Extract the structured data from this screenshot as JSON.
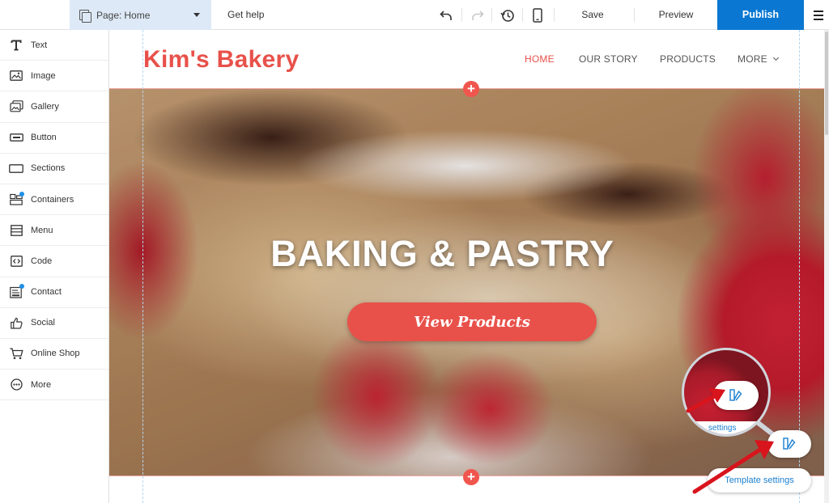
{
  "toolbar": {
    "page_prefix": "Page:",
    "page_name": "Home",
    "get_help": "Get help",
    "save": "Save",
    "preview": "Preview",
    "publish": "Publish",
    "icons": [
      "undo-icon",
      "redo-icon",
      "history-icon",
      "mobile-view-icon",
      "menu-icon"
    ],
    "publish_color": "#0a78d2"
  },
  "sidebar": {
    "items": [
      {
        "label": "Text",
        "icon": "text-icon"
      },
      {
        "label": "Image",
        "icon": "image-icon"
      },
      {
        "label": "Gallery",
        "icon": "gallery-icon"
      },
      {
        "label": "Button",
        "icon": "button-icon"
      },
      {
        "label": "Sections",
        "icon": "sections-icon"
      },
      {
        "label": "Containers",
        "icon": "containers-icon",
        "badge": true
      },
      {
        "label": "Menu",
        "icon": "menu-list-icon"
      },
      {
        "label": "Code",
        "icon": "code-icon"
      },
      {
        "label": "Contact",
        "icon": "contact-icon",
        "badge": true
      },
      {
        "label": "Social",
        "icon": "thumbs-up-icon"
      },
      {
        "label": "Online Shop",
        "icon": "cart-icon"
      },
      {
        "label": "More",
        "icon": "more-icon"
      }
    ]
  },
  "site": {
    "logo": "Kim's Bakery",
    "brand_color": "#e8514a",
    "nav": [
      "HOME",
      "OUR STORY",
      "PRODUCTS",
      "MORE"
    ],
    "active_nav": "HOME",
    "hero_title": "BAKING & PASTRY",
    "hero_button": "View Products"
  },
  "callout": {
    "magnified_label": "settings",
    "template_settings": "Template settings"
  }
}
